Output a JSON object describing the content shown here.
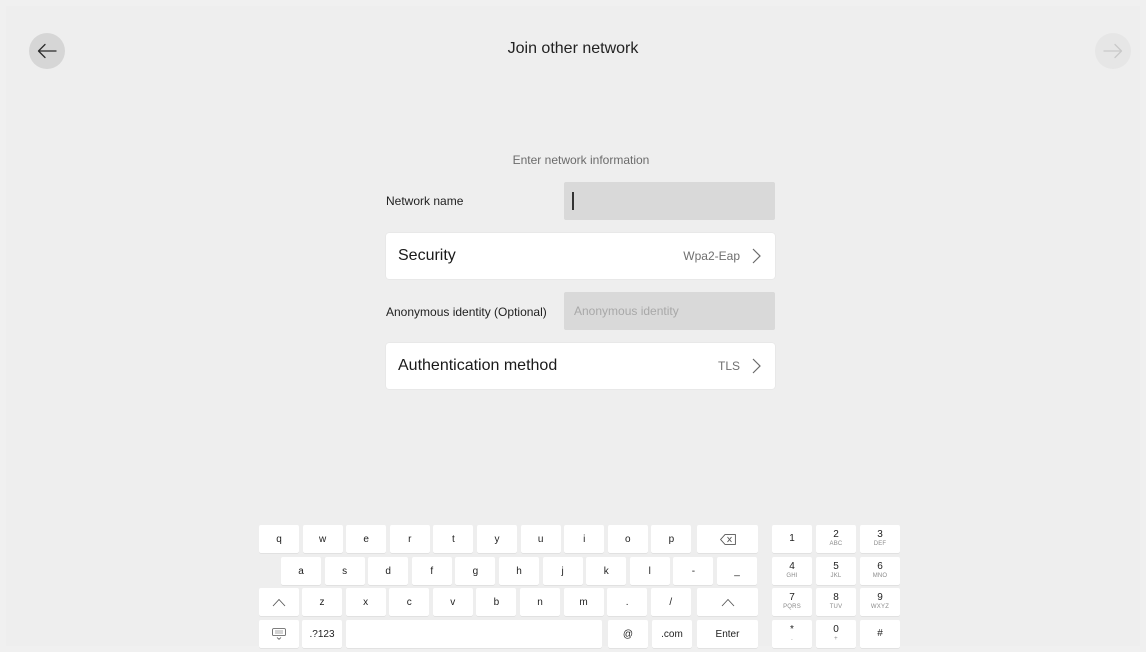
{
  "header": {
    "title": "Join other network"
  },
  "form": {
    "subtitle": "Enter network information",
    "network_name_label": "Network name",
    "network_name_value": "",
    "security_label": "Security",
    "security_value": "Wpa2-Eap",
    "anon_label": "Anonymous identity (Optional)",
    "anon_placeholder": "Anonymous identity",
    "auth_label": "Authentication method",
    "auth_value": "TLS"
  },
  "keyboard": {
    "row1": [
      "q",
      "w",
      "e",
      "r",
      "t",
      "y",
      "u",
      "i",
      "o",
      "p"
    ],
    "row2": [
      "a",
      "s",
      "d",
      "f",
      "g",
      "h",
      "j",
      "k",
      "l",
      "-",
      "_"
    ],
    "row3": [
      "z",
      "x",
      "c",
      "v",
      "b",
      "n",
      "m",
      ".",
      "/"
    ],
    "sym_label": ".?123",
    "at_label": "@",
    "dotcom_label": ".com",
    "enter_label": "Enter",
    "numpad": [
      {
        "digit": "1",
        "letters": ""
      },
      {
        "digit": "2",
        "letters": "ABC"
      },
      {
        "digit": "3",
        "letters": "DEF"
      },
      {
        "digit": "4",
        "letters": "GHI"
      },
      {
        "digit": "5",
        "letters": "JKL"
      },
      {
        "digit": "6",
        "letters": "MNO"
      },
      {
        "digit": "7",
        "letters": "PQRS"
      },
      {
        "digit": "8",
        "letters": "TUV"
      },
      {
        "digit": "9",
        "letters": "WXYZ"
      },
      {
        "digit": "*",
        "letters": "."
      },
      {
        "digit": "0",
        "letters": "+"
      },
      {
        "digit": "#",
        "letters": ""
      }
    ]
  },
  "icons": {
    "back": "arrow-left-icon",
    "forward": "arrow-right-icon",
    "chevron": "chevron-right-icon",
    "backspace": "backspace-icon",
    "shift": "shift-icon",
    "hide_keyboard": "keyboard-hide-icon"
  },
  "colors": {
    "background": "#eeeeee",
    "input_fill": "#d9d9d9",
    "card": "#ffffff"
  }
}
